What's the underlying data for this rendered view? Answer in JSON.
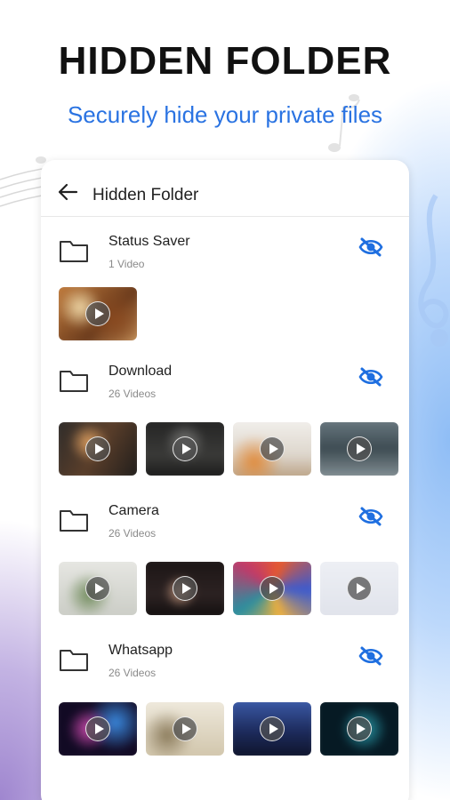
{
  "promo": {
    "title": "HIDDEN FOLDER",
    "subtitle": "Securely hide your private files"
  },
  "header": {
    "back_icon": "arrow-left-icon",
    "title": "Hidden Folder"
  },
  "folders": [
    {
      "name": "Status Saver",
      "count": "1 Video",
      "icon": "folder-icon",
      "action_icon": "eye-off-icon",
      "thumbnails": 1
    },
    {
      "name": "Download",
      "count": "26 Videos",
      "icon": "folder-icon",
      "action_icon": "eye-off-icon",
      "thumbnails": 4
    },
    {
      "name": "Camera",
      "count": "26 Videos",
      "icon": "folder-icon",
      "action_icon": "eye-off-icon",
      "thumbnails": 4
    },
    {
      "name": "Whatsapp",
      "count": "26 Videos",
      "icon": "folder-icon",
      "action_icon": "eye-off-icon",
      "thumbnails": 4
    }
  ],
  "colors": {
    "accent": "#2a73e2",
    "title": "#111111",
    "eye_icon": "#1f6fe0"
  }
}
